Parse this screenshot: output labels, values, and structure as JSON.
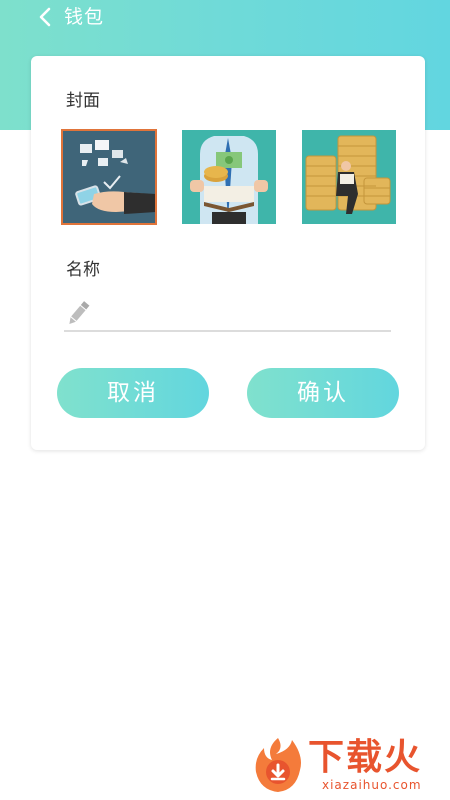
{
  "header": {
    "title": "钱包"
  },
  "card": {
    "cover_label": "封面",
    "covers": [
      {
        "name": "mobile-shopping",
        "selected": true
      },
      {
        "name": "businessman-money-book",
        "selected": false
      },
      {
        "name": "man-on-coins",
        "selected": false
      }
    ],
    "name_label": "名称",
    "name_value": "",
    "name_icon": "pencil-icon",
    "cancel_label": "取消",
    "confirm_label": "确认"
  },
  "watermark": {
    "text": "下载火",
    "subtext": "xiazaihuo.com"
  },
  "colors": {
    "accent_start": "#7ee0cc",
    "accent_end": "#62d6e0",
    "selected_border": "#e0743a",
    "watermark": "#e8542e"
  }
}
